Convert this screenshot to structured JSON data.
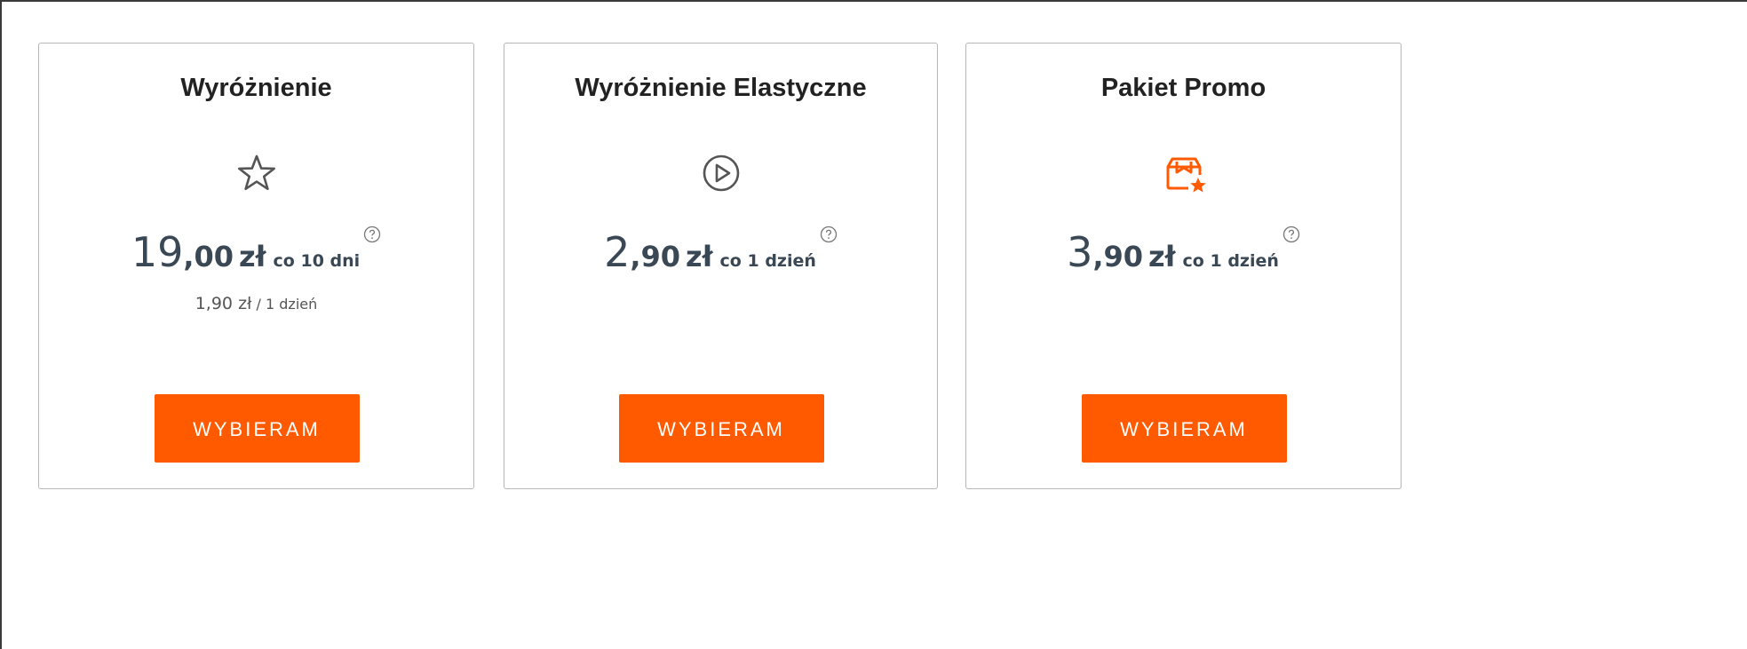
{
  "colors": {
    "accent": "#ff5a00",
    "border": "#b7b7b7",
    "text": "#3a4754"
  },
  "offers": [
    {
      "title": "Wyróżnienie",
      "icon": "star-outline-icon",
      "price_int": "19",
      "price_dec": ",00",
      "currency": "zł",
      "period": "co 10 dni",
      "subline_price": "1,90 zł",
      "subline_period": "/ 1 dzień",
      "button": "WYBIERAM"
    },
    {
      "title": "Wyróżnienie Elastyczne",
      "icon": "play-circle-icon",
      "price_int": "2",
      "price_dec": ",90",
      "currency": "zł",
      "period": "co 1 dzień",
      "button": "WYBIERAM"
    },
    {
      "title": "Pakiet Promo",
      "icon": "promo-package-icon",
      "price_int": "3",
      "price_dec": ",90",
      "currency": "zł",
      "period": "co 1 dzień",
      "button": "WYBIERAM"
    }
  ]
}
